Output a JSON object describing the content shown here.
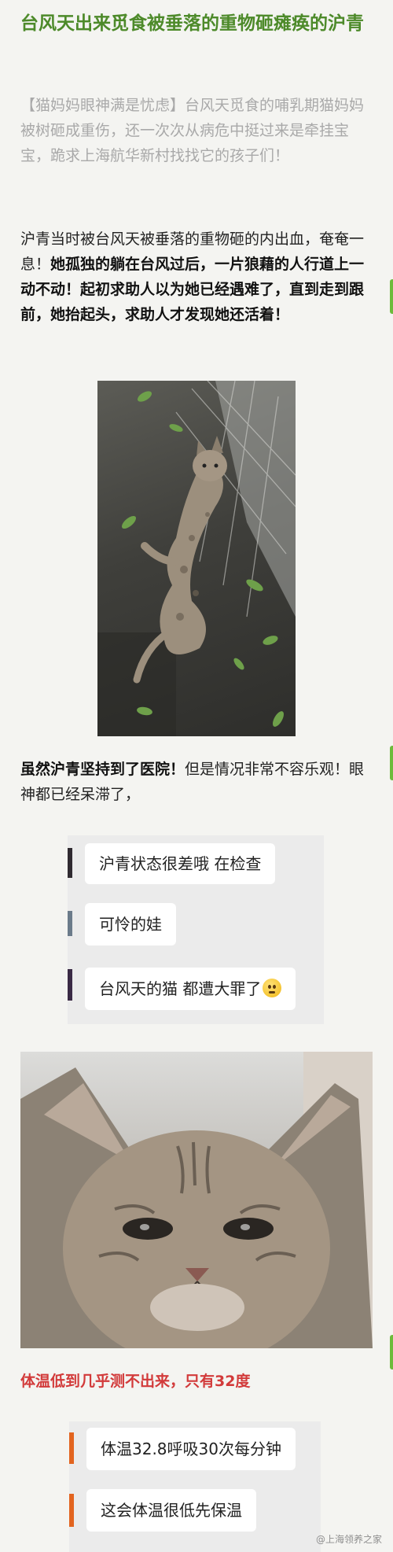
{
  "article": {
    "title": "台风天出来觅食被垂落的重物砸瘫痪的沪青",
    "lead_tag": "【猫妈妈眼神满是忧虑】",
    "lead_text": "台风天觅食的哺乳期猫妈妈被树砸成重伤，还一次次从病危中挺过来是牵挂宝宝，跪求上海航华新村找找它的孩子们！",
    "para1_normal": "沪青当时被台风天被垂落的重物砸的内出血，奄奄一息！",
    "para1_bold": "她孤独的躺在台风过后，一片狼藉的人行道上一动不动！起初求助人以为她已经遇难了，直到走到跟前，她抬起头，求助人才发现她还活着！",
    "para2_bold": "虽然沪青坚持到了医院！",
    "para2_normal": "但是情况非常不容乐观！眼神都已经呆滞了，",
    "para3": "体温低到几乎测不出来，只有32度"
  },
  "chat1": {
    "messages": [
      "沪青状态很差哦 在检查",
      "可怜的娃",
      "台风天的猫 都遭大罪了"
    ]
  },
  "chat2": {
    "messages": [
      "体温32.8呼吸30次每分钟",
      "这会体温很低先保温"
    ]
  },
  "watermark": "@上海领养之家",
  "colors": {
    "title_green": "#4d8a2a",
    "alert_red": "#d23a3a",
    "lead_gray": "#a9a9a9"
  }
}
